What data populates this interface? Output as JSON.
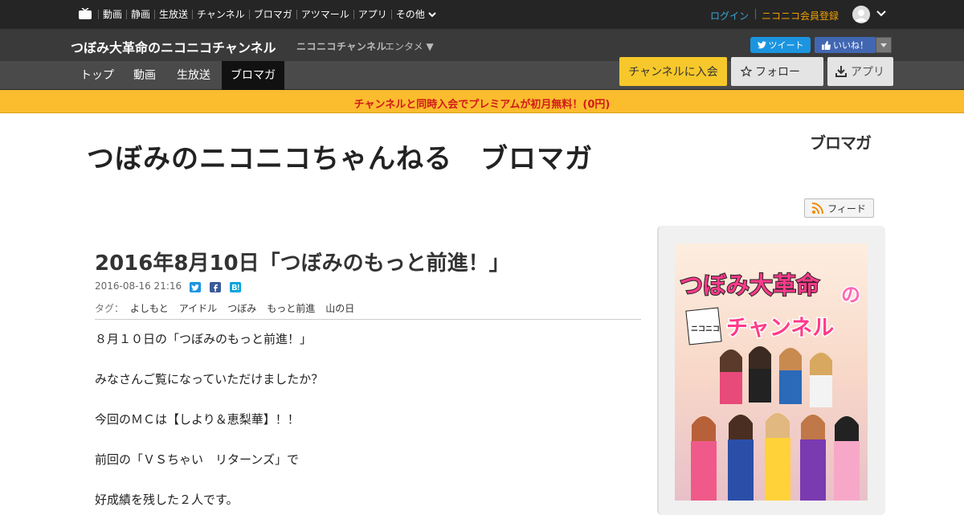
{
  "globalnav": {
    "items": [
      "動画",
      "静画",
      "生放送",
      "チャンネル",
      "ブロマガ",
      "アツマール",
      "アプリ"
    ],
    "more": "その他",
    "login": "ログイン",
    "register": "ニコニコ会員登録"
  },
  "channel": {
    "title": "つぼみ大革命のニコニコチャンネル",
    "service_logo": "ニコニコチャンネル",
    "category": "エンタメ ▼",
    "tweet": "ツイート",
    "like": "いいね！"
  },
  "tabs": [
    "トップ",
    "動画",
    "生放送",
    "ブロマガ"
  ],
  "active_tab": "ブロマガ",
  "actions": {
    "join": "チャンネルに入会",
    "follow": "フォロー",
    "app": "アプリ"
  },
  "promo": "チャンネルと同時入会でプレミアムが初月無料！(0円)",
  "blog": {
    "title": "つぼみのニコニコちゃんねる　ブロマガ",
    "logo": "ブロマガ",
    "feed": "フィード"
  },
  "article": {
    "title": "2016年8月10日「つぼみのもっと前進！」",
    "date": "2016-08-16 21:16",
    "tag_label": "タグ：",
    "tags": [
      "よしもと",
      "アイドル",
      "つぼみ",
      "もっと前進",
      "山の日"
    ],
    "paragraphs": [
      "８月１０日の「つぼみのもっと前進！」",
      "みなさんご覧になっていただけましたか？",
      "今回のＭＣは【しより＆恵梨華】！！",
      "前回の「ＶＳちゃい　リターンズ」で",
      "好成績を残した２人です。"
    ]
  },
  "sidebar": {
    "banner_line1": "つぼみ大革命",
    "banner_no": "の",
    "banner_niconico": "ニコニコ",
    "banner_line2": "チャンネル"
  },
  "colors": {
    "accent_yellow": "#f6c82b",
    "promo_bg": "#fbbc2d",
    "promo_text": "#d11a1a",
    "twitter": "#1b95e0",
    "facebook": "#4267b2",
    "hatena": "#00a4de"
  }
}
